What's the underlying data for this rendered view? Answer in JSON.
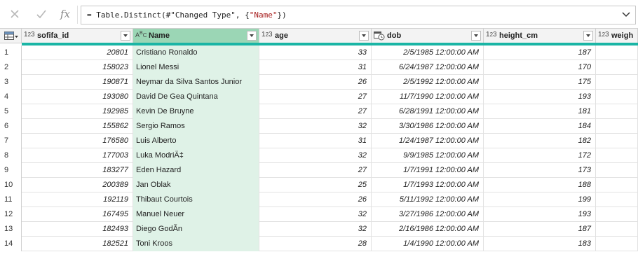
{
  "formula_bar": {
    "cancel_icon": "close-icon",
    "commit_icon": "check-icon",
    "fx_label": "fx",
    "formula_prefix": "= Table.Distinct(#\"Changed Type\", {",
    "formula_string": "\"Name\"",
    "formula_suffix": "})"
  },
  "columns": [
    {
      "key": "sofifa_id",
      "label": "sofifa_id",
      "type_icon": "123",
      "align": "num"
    },
    {
      "key": "name",
      "label": "Name",
      "type_icon": "ABC",
      "align": "txt",
      "selected": true
    },
    {
      "key": "age",
      "label": "age",
      "type_icon": "123",
      "align": "num"
    },
    {
      "key": "dob",
      "label": "dob",
      "type_icon": "calendar-clock",
      "align": "date"
    },
    {
      "key": "height_cm",
      "label": "height_cm",
      "type_icon": "123",
      "align": "num"
    },
    {
      "key": "weight",
      "label": "weigh",
      "type_icon": "123",
      "align": "num"
    }
  ],
  "rows": [
    {
      "n": "1",
      "sofifa_id": "20801",
      "name": "Cristiano Ronaldo",
      "age": "33",
      "dob": "2/5/1985 12:00:00 AM",
      "height_cm": "187"
    },
    {
      "n": "2",
      "sofifa_id": "158023",
      "name": "Lionel Messi",
      "age": "31",
      "dob": "6/24/1987 12:00:00 AM",
      "height_cm": "170"
    },
    {
      "n": "3",
      "sofifa_id": "190871",
      "name": "Neymar da Silva Santos Junior",
      "age": "26",
      "dob": "2/5/1992 12:00:00 AM",
      "height_cm": "175"
    },
    {
      "n": "4",
      "sofifa_id": "193080",
      "name": "David De Gea Quintana",
      "age": "27",
      "dob": "11/7/1990 12:00:00 AM",
      "height_cm": "193"
    },
    {
      "n": "5",
      "sofifa_id": "192985",
      "name": "Kevin De Bruyne",
      "age": "27",
      "dob": "6/28/1991 12:00:00 AM",
      "height_cm": "181"
    },
    {
      "n": "6",
      "sofifa_id": "155862",
      "name": "Sergio Ramos",
      "age": "32",
      "dob": "3/30/1986 12:00:00 AM",
      "height_cm": "184"
    },
    {
      "n": "7",
      "sofifa_id": "176580",
      "name": "Luis Alberto",
      "age": "31",
      "dob": "1/24/1987 12:00:00 AM",
      "height_cm": "182"
    },
    {
      "n": "8",
      "sofifa_id": "177003",
      "name": "Luka ModriÄ‡",
      "age": "32",
      "dob": "9/9/1985 12:00:00 AM",
      "height_cm": "172"
    },
    {
      "n": "9",
      "sofifa_id": "183277",
      "name": "Eden Hazard",
      "age": "27",
      "dob": "1/7/1991 12:00:00 AM",
      "height_cm": "173"
    },
    {
      "n": "10",
      "sofifa_id": "200389",
      "name": "Jan Oblak",
      "age": "25",
      "dob": "1/7/1993 12:00:00 AM",
      "height_cm": "188"
    },
    {
      "n": "11",
      "sofifa_id": "192119",
      "name": "Thibaut Courtois",
      "age": "26",
      "dob": "5/11/1992 12:00:00 AM",
      "height_cm": "199"
    },
    {
      "n": "12",
      "sofifa_id": "167495",
      "name": "Manuel Neuer",
      "age": "32",
      "dob": "3/27/1986 12:00:00 AM",
      "height_cm": "193"
    },
    {
      "n": "13",
      "sofifa_id": "182493",
      "name": "Diego GodÃn",
      "age": "32",
      "dob": "2/16/1986 12:00:00 AM",
      "height_cm": "187"
    },
    {
      "n": "14",
      "sofifa_id": "182521",
      "name": "Toni Kroos",
      "age": "28",
      "dob": "1/4/1990 12:00:00 AM",
      "height_cm": "183"
    }
  ]
}
